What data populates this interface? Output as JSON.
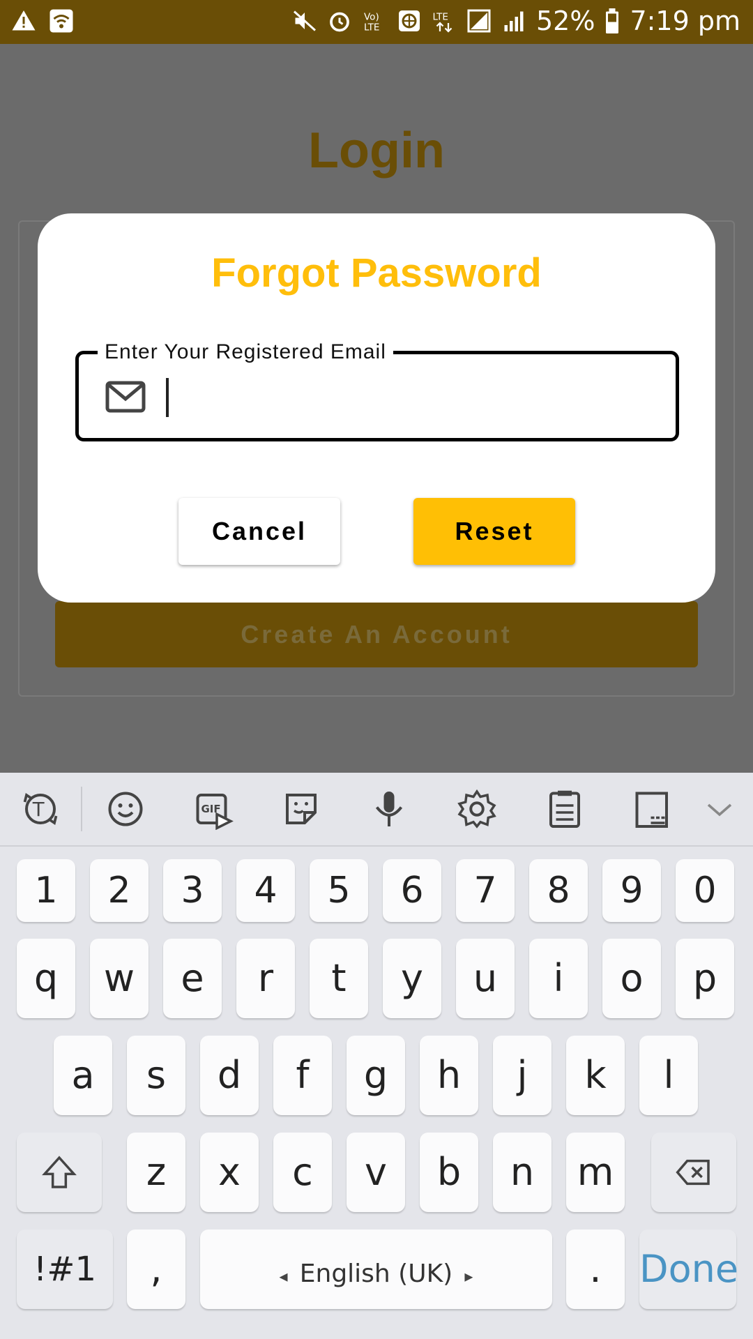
{
  "status_bar": {
    "battery_percent": "52%",
    "time": "7:19 pm",
    "icons": [
      "warning-icon",
      "wifi-icon",
      "mute-icon",
      "alarm-icon",
      "volte-icon",
      "data-icon",
      "lte-icon",
      "signal-icon",
      "signal2-icon",
      "battery-icon"
    ]
  },
  "page": {
    "title": "Login",
    "create_account_label": "Create An Account"
  },
  "dialog": {
    "title": "Forgot Password",
    "email_label": "Enter Your Registered Email",
    "email_value": "",
    "cancel_label": "Cancel",
    "reset_label": "Reset",
    "accent_color": "#ffbe0b"
  },
  "keyboard": {
    "toolbar_icons": [
      "text-mode-icon",
      "emoji-icon",
      "gif-icon",
      "sticker-icon",
      "microphone-icon",
      "settings-icon",
      "clipboard-icon",
      "keyboard-layout-icon",
      "collapse-icon"
    ],
    "number_row": [
      "1",
      "2",
      "3",
      "4",
      "5",
      "6",
      "7",
      "8",
      "9",
      "0"
    ],
    "row1": [
      "q",
      "w",
      "e",
      "r",
      "t",
      "y",
      "u",
      "i",
      "o",
      "p"
    ],
    "row2": [
      "a",
      "s",
      "d",
      "f",
      "g",
      "h",
      "j",
      "k",
      "l"
    ],
    "row3": [
      "z",
      "x",
      "c",
      "v",
      "b",
      "n",
      "m"
    ],
    "symbols_label": "!#1",
    "comma": ",",
    "space_label": "English (UK)",
    "period": ".",
    "done_label": "Done"
  }
}
